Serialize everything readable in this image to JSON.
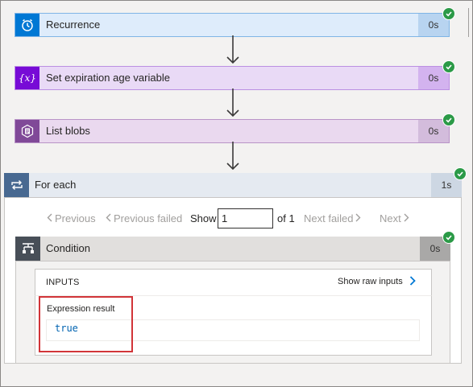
{
  "steps": [
    {
      "label": "Recurrence",
      "duration": "0s"
    },
    {
      "label": "Set expiration age variable",
      "duration": "0s"
    },
    {
      "label": "List blobs",
      "duration": "0s"
    }
  ],
  "variable_icon_text": "{x}",
  "foreach": {
    "label": "For each",
    "duration": "1s",
    "pagination": {
      "previous": "Previous",
      "previous_failed": "Previous failed",
      "show": "Show",
      "page_value": "1",
      "of": "of 1",
      "next_failed": "Next failed",
      "next": "Next"
    }
  },
  "condition": {
    "label": "Condition",
    "duration": "0s",
    "inputs_title": "INPUTS",
    "show_raw": "Show raw inputs",
    "expression_label": "Expression result",
    "expression_value": "true"
  },
  "colors": {
    "recurrence": "#0078d4",
    "variable": "#770bd6",
    "blob": "#804998",
    "foreach": "#486991",
    "condition": "#484f58",
    "success": "#2b9a47",
    "highlight": "#d13438",
    "link": "#0078d4"
  }
}
